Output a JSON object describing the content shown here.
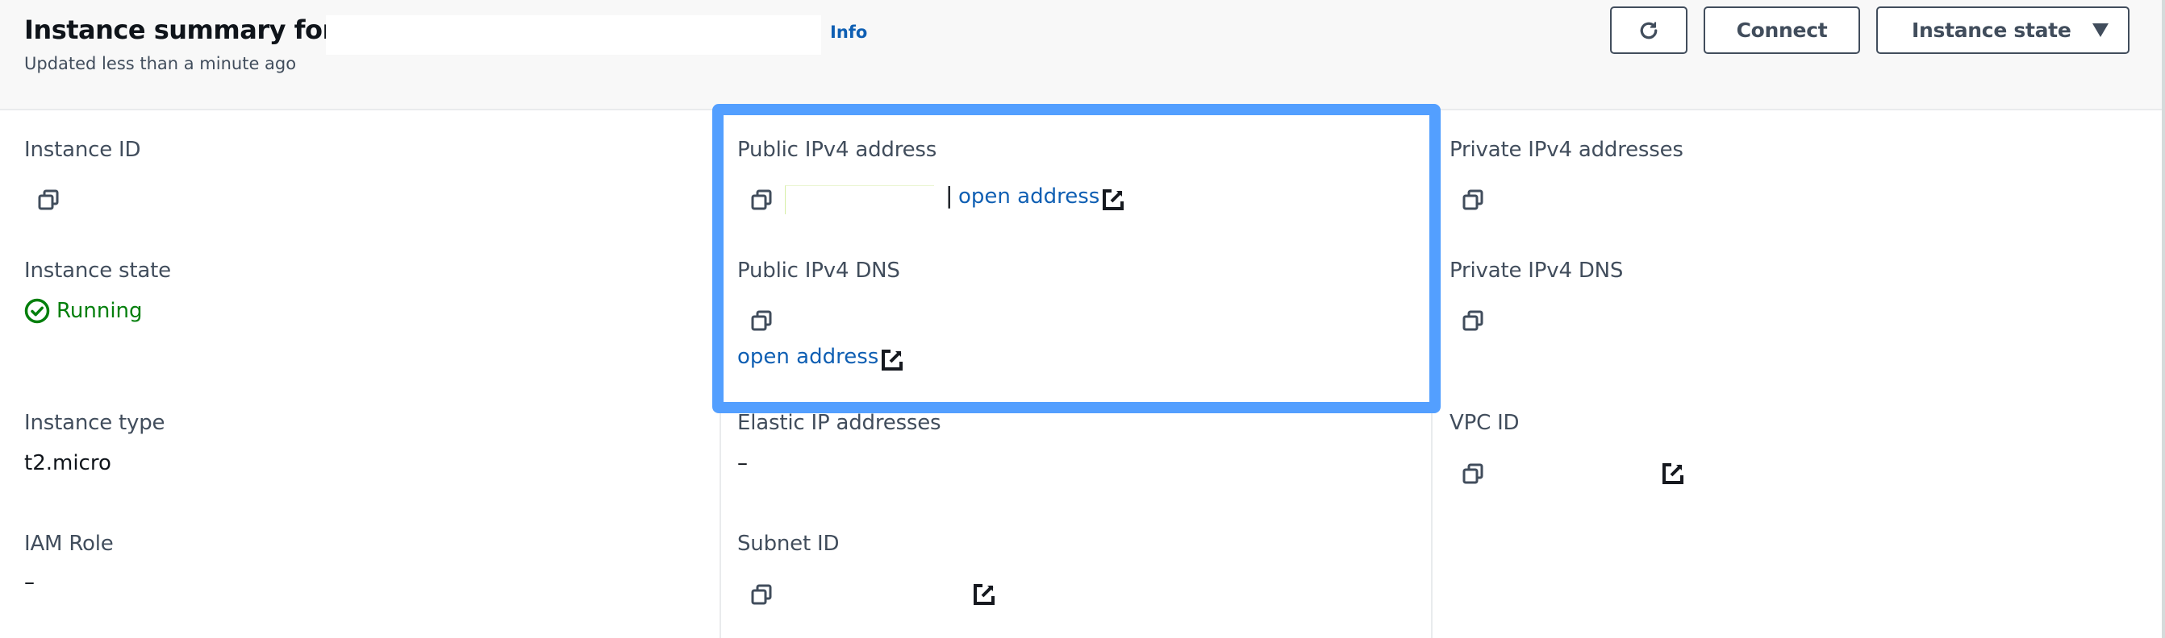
{
  "header": {
    "title": "Instance summary for",
    "instance_name_redacted": "",
    "info_label": "Info",
    "subtitle": "Updated less than a minute ago",
    "buttons": {
      "refresh_icon": "refresh-icon",
      "connect_label": "Connect",
      "instance_state_label": "Instance state"
    }
  },
  "details": {
    "instance_id": {
      "label": "Instance ID",
      "value": ""
    },
    "public_ipv4_address": {
      "label": "Public IPv4 address",
      "value": "",
      "separator": "|",
      "link_label": "open address"
    },
    "private_ipv4_addresses": {
      "label": "Private IPv4 addresses",
      "value": ""
    },
    "instance_state": {
      "label": "Instance state",
      "value": "Running"
    },
    "public_ipv4_dns": {
      "label": "Public IPv4 DNS",
      "value": "",
      "link_label": "open address"
    },
    "private_ipv4_dns": {
      "label": "Private IPv4 DNS",
      "value": ""
    },
    "instance_type": {
      "label": "Instance type",
      "value": "t2.micro"
    },
    "elastic_ip_addresses": {
      "label": "Elastic IP addresses",
      "value": "–"
    },
    "vpc_id": {
      "label": "VPC ID",
      "value": ""
    },
    "iam_role": {
      "label": "IAM Role",
      "value": "–"
    },
    "subnet_id": {
      "label": "Subnet ID",
      "value": ""
    }
  },
  "colors": {
    "highlight": "#539fff",
    "link": "#0f5fb3",
    "status_running": "#037f0c",
    "text_secondary": "#414d5c",
    "header_bg": "#f8f8f8"
  }
}
